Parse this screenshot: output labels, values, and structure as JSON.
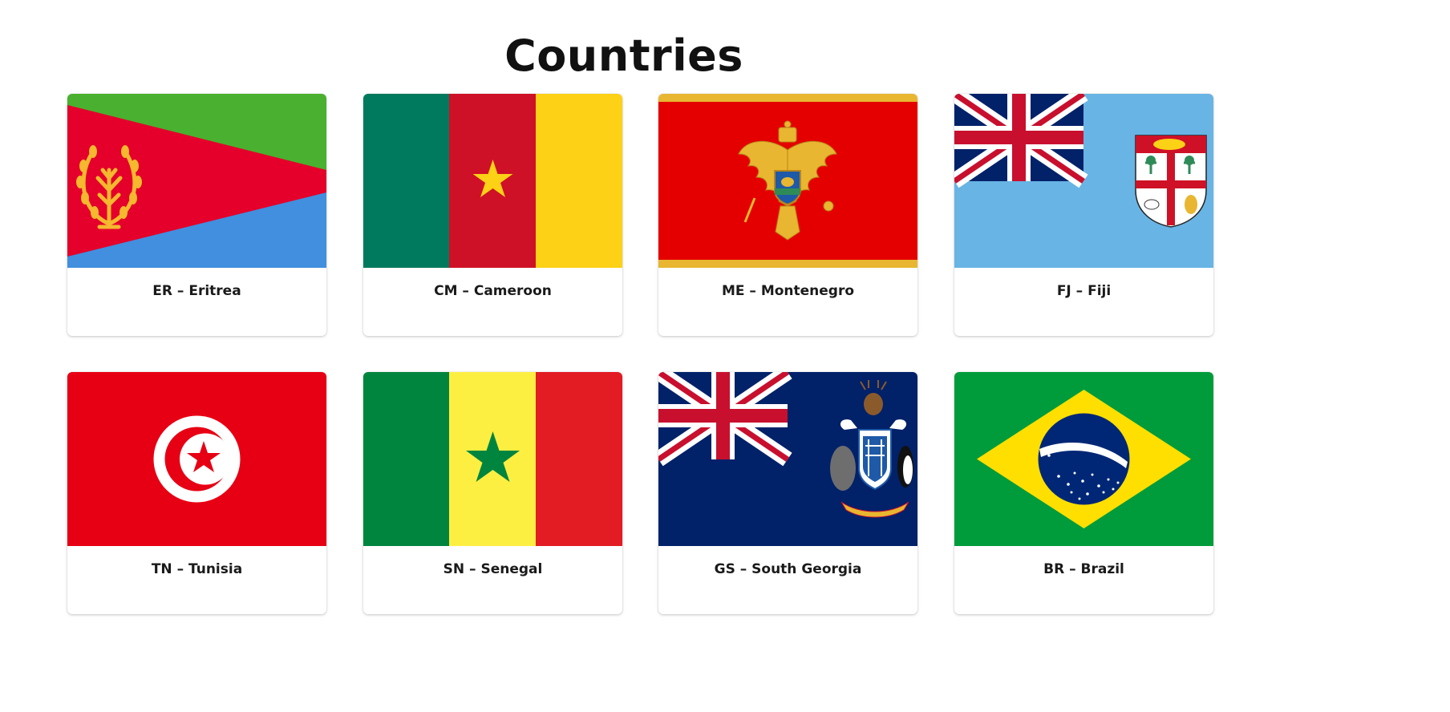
{
  "page": {
    "title": "Countries"
  },
  "cards": [
    {
      "label": "ER – Eritrea",
      "flag_icon": "eritrea-flag-icon"
    },
    {
      "label": "CM – Cameroon",
      "flag_icon": "cameroon-flag-icon"
    },
    {
      "label": "ME – Montenegro",
      "flag_icon": "montenegro-flag-icon"
    },
    {
      "label": "FJ – Fiji",
      "flag_icon": "fiji-flag-icon"
    },
    {
      "label": "TN – Tunisia",
      "flag_icon": "tunisia-flag-icon"
    },
    {
      "label": "SN – Senegal",
      "flag_icon": "senegal-flag-icon"
    },
    {
      "label": "GS – South Georgia",
      "flag_icon": "south-georgia-flag-icon"
    },
    {
      "label": "BR – Brazil",
      "flag_icon": "brazil-flag-icon"
    }
  ],
  "colors": {
    "eritrea_green": "#4AB030",
    "eritrea_red": "#E4002B",
    "eritrea_blue": "#418FDE",
    "eritrea_gold": "#F5B82E",
    "cameroon_green": "#007A5E",
    "cameroon_red": "#CE1126",
    "cameroon_yellow": "#FCD116",
    "montenegro_red": "#E50000",
    "montenegro_gold": "#E8B630",
    "fiji_light_blue": "#68B4E4",
    "union_blue": "#012169",
    "union_red": "#C8102E",
    "tunisia_red": "#E70013",
    "senegal_green": "#00853F",
    "senegal_yellow": "#FDEF42",
    "senegal_red": "#E31B23",
    "south_georgia_blue": "#012169",
    "brazil_green": "#009C3B",
    "brazil_yellow": "#FFDF00",
    "brazil_blue": "#002776"
  }
}
